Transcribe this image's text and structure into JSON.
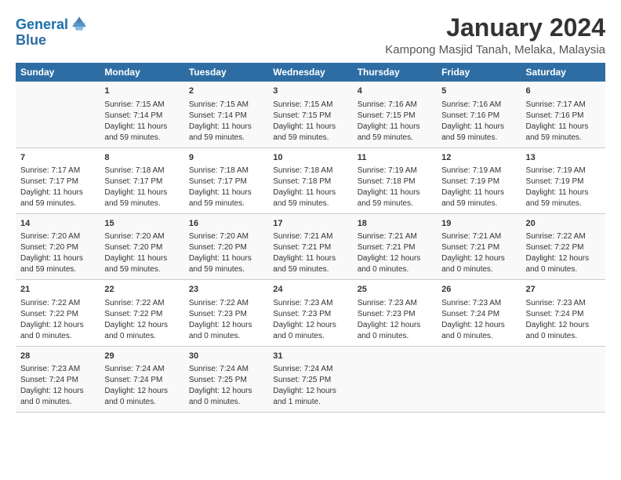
{
  "logo": {
    "line1": "General",
    "line2": "Blue"
  },
  "title": "January 2024",
  "subtitle": "Kampong Masjid Tanah, Melaka, Malaysia",
  "headers": [
    "Sunday",
    "Monday",
    "Tuesday",
    "Wednesday",
    "Thursday",
    "Friday",
    "Saturday"
  ],
  "weeks": [
    [
      {
        "day": "",
        "sunrise": "",
        "sunset": "",
        "daylight": ""
      },
      {
        "day": "1",
        "sunrise": "Sunrise: 7:15 AM",
        "sunset": "Sunset: 7:14 PM",
        "daylight": "Daylight: 11 hours and 59 minutes."
      },
      {
        "day": "2",
        "sunrise": "Sunrise: 7:15 AM",
        "sunset": "Sunset: 7:14 PM",
        "daylight": "Daylight: 11 hours and 59 minutes."
      },
      {
        "day": "3",
        "sunrise": "Sunrise: 7:15 AM",
        "sunset": "Sunset: 7:15 PM",
        "daylight": "Daylight: 11 hours and 59 minutes."
      },
      {
        "day": "4",
        "sunrise": "Sunrise: 7:16 AM",
        "sunset": "Sunset: 7:15 PM",
        "daylight": "Daylight: 11 hours and 59 minutes."
      },
      {
        "day": "5",
        "sunrise": "Sunrise: 7:16 AM",
        "sunset": "Sunset: 7:16 PM",
        "daylight": "Daylight: 11 hours and 59 minutes."
      },
      {
        "day": "6",
        "sunrise": "Sunrise: 7:17 AM",
        "sunset": "Sunset: 7:16 PM",
        "daylight": "Daylight: 11 hours and 59 minutes."
      }
    ],
    [
      {
        "day": "7",
        "sunrise": "Sunrise: 7:17 AM",
        "sunset": "Sunset: 7:17 PM",
        "daylight": "Daylight: 11 hours and 59 minutes."
      },
      {
        "day": "8",
        "sunrise": "Sunrise: 7:18 AM",
        "sunset": "Sunset: 7:17 PM",
        "daylight": "Daylight: 11 hours and 59 minutes."
      },
      {
        "day": "9",
        "sunrise": "Sunrise: 7:18 AM",
        "sunset": "Sunset: 7:17 PM",
        "daylight": "Daylight: 11 hours and 59 minutes."
      },
      {
        "day": "10",
        "sunrise": "Sunrise: 7:18 AM",
        "sunset": "Sunset: 7:18 PM",
        "daylight": "Daylight: 11 hours and 59 minutes."
      },
      {
        "day": "11",
        "sunrise": "Sunrise: 7:19 AM",
        "sunset": "Sunset: 7:18 PM",
        "daylight": "Daylight: 11 hours and 59 minutes."
      },
      {
        "day": "12",
        "sunrise": "Sunrise: 7:19 AM",
        "sunset": "Sunset: 7:19 PM",
        "daylight": "Daylight: 11 hours and 59 minutes."
      },
      {
        "day": "13",
        "sunrise": "Sunrise: 7:19 AM",
        "sunset": "Sunset: 7:19 PM",
        "daylight": "Daylight: 11 hours and 59 minutes."
      }
    ],
    [
      {
        "day": "14",
        "sunrise": "Sunrise: 7:20 AM",
        "sunset": "Sunset: 7:20 PM",
        "daylight": "Daylight: 11 hours and 59 minutes."
      },
      {
        "day": "15",
        "sunrise": "Sunrise: 7:20 AM",
        "sunset": "Sunset: 7:20 PM",
        "daylight": "Daylight: 11 hours and 59 minutes."
      },
      {
        "day": "16",
        "sunrise": "Sunrise: 7:20 AM",
        "sunset": "Sunset: 7:20 PM",
        "daylight": "Daylight: 11 hours and 59 minutes."
      },
      {
        "day": "17",
        "sunrise": "Sunrise: 7:21 AM",
        "sunset": "Sunset: 7:21 PM",
        "daylight": "Daylight: 11 hours and 59 minutes."
      },
      {
        "day": "18",
        "sunrise": "Sunrise: 7:21 AM",
        "sunset": "Sunset: 7:21 PM",
        "daylight": "Daylight: 12 hours and 0 minutes."
      },
      {
        "day": "19",
        "sunrise": "Sunrise: 7:21 AM",
        "sunset": "Sunset: 7:21 PM",
        "daylight": "Daylight: 12 hours and 0 minutes."
      },
      {
        "day": "20",
        "sunrise": "Sunrise: 7:22 AM",
        "sunset": "Sunset: 7:22 PM",
        "daylight": "Daylight: 12 hours and 0 minutes."
      }
    ],
    [
      {
        "day": "21",
        "sunrise": "Sunrise: 7:22 AM",
        "sunset": "Sunset: 7:22 PM",
        "daylight": "Daylight: 12 hours and 0 minutes."
      },
      {
        "day": "22",
        "sunrise": "Sunrise: 7:22 AM",
        "sunset": "Sunset: 7:22 PM",
        "daylight": "Daylight: 12 hours and 0 minutes."
      },
      {
        "day": "23",
        "sunrise": "Sunrise: 7:22 AM",
        "sunset": "Sunset: 7:23 PM",
        "daylight": "Daylight: 12 hours and 0 minutes."
      },
      {
        "day": "24",
        "sunrise": "Sunrise: 7:23 AM",
        "sunset": "Sunset: 7:23 PM",
        "daylight": "Daylight: 12 hours and 0 minutes."
      },
      {
        "day": "25",
        "sunrise": "Sunrise: 7:23 AM",
        "sunset": "Sunset: 7:23 PM",
        "daylight": "Daylight: 12 hours and 0 minutes."
      },
      {
        "day": "26",
        "sunrise": "Sunrise: 7:23 AM",
        "sunset": "Sunset: 7:24 PM",
        "daylight": "Daylight: 12 hours and 0 minutes."
      },
      {
        "day": "27",
        "sunrise": "Sunrise: 7:23 AM",
        "sunset": "Sunset: 7:24 PM",
        "daylight": "Daylight: 12 hours and 0 minutes."
      }
    ],
    [
      {
        "day": "28",
        "sunrise": "Sunrise: 7:23 AM",
        "sunset": "Sunset: 7:24 PM",
        "daylight": "Daylight: 12 hours and 0 minutes."
      },
      {
        "day": "29",
        "sunrise": "Sunrise: 7:24 AM",
        "sunset": "Sunset: 7:24 PM",
        "daylight": "Daylight: 12 hours and 0 minutes."
      },
      {
        "day": "30",
        "sunrise": "Sunrise: 7:24 AM",
        "sunset": "Sunset: 7:25 PM",
        "daylight": "Daylight: 12 hours and 0 minutes."
      },
      {
        "day": "31",
        "sunrise": "Sunrise: 7:24 AM",
        "sunset": "Sunset: 7:25 PM",
        "daylight": "Daylight: 12 hours and 1 minute."
      },
      {
        "day": "",
        "sunrise": "",
        "sunset": "",
        "daylight": ""
      },
      {
        "day": "",
        "sunrise": "",
        "sunset": "",
        "daylight": ""
      },
      {
        "day": "",
        "sunrise": "",
        "sunset": "",
        "daylight": ""
      }
    ]
  ]
}
